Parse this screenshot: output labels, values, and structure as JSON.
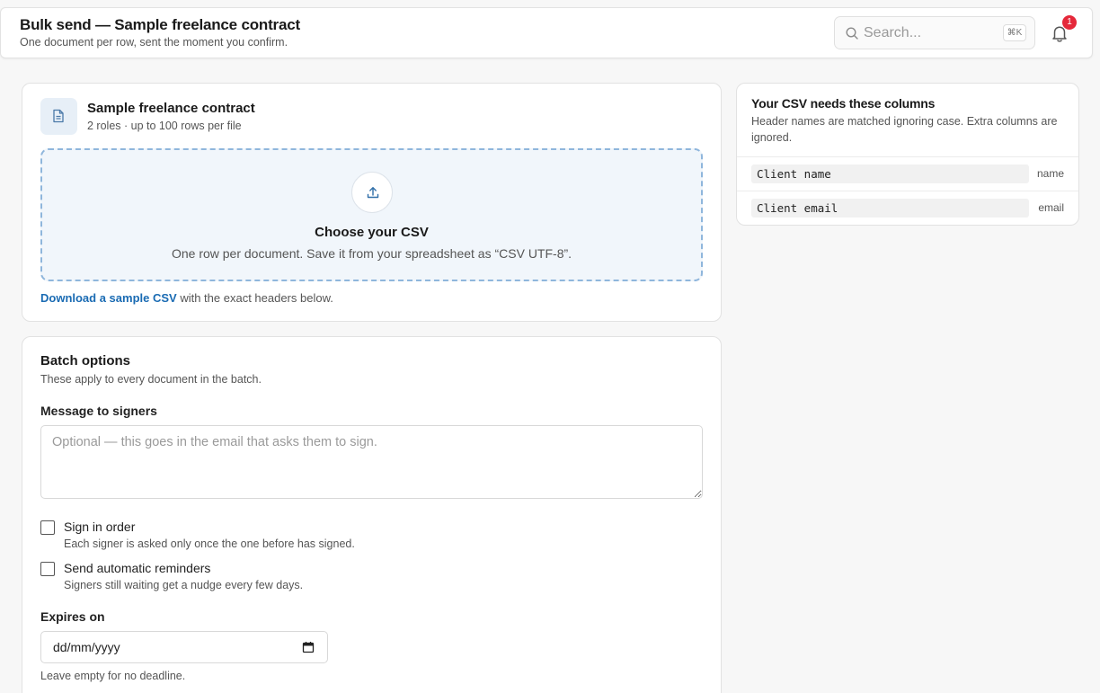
{
  "header": {
    "title": "Bulk send — Sample freelance contract",
    "subtitle": "One document per row, sent the moment you confirm.",
    "search_placeholder": "Search...",
    "search_shortcut": "⌘K",
    "notification_count": "1"
  },
  "template": {
    "name": "Sample freelance contract",
    "meta": "2 roles · up to 100 rows per file"
  },
  "upload": {
    "title": "Choose your CSV",
    "subtitle": "One row per document. Save it from your spreadsheet as “CSV UTF-8”.",
    "sample_link": "Download a sample CSV",
    "sample_suffix": " with the exact headers below."
  },
  "batch_options": {
    "title": "Batch options",
    "subtitle": "These apply to every document in the batch.",
    "message_label": "Message to signers",
    "message_placeholder": "Optional — this goes in the email that asks them to sign.",
    "sign_in_order": {
      "label": "Sign in order",
      "help": "Each signer is asked only once the one before has signed.",
      "checked": false
    },
    "reminders": {
      "label": "Send automatic reminders",
      "help": "Signers still waiting get a nudge every few days.",
      "checked": false
    },
    "expires_label": "Expires on",
    "expires_placeholder": "dd/mm/yyyy",
    "expires_help": "Leave empty for no deadline."
  },
  "csv_columns": {
    "title": "Your CSV needs these columns",
    "subtitle": "Header names are matched ignoring case. Extra columns are ignored.",
    "columns": [
      {
        "header": "Client name",
        "field": "name"
      },
      {
        "header": "Client email",
        "field": "email"
      }
    ]
  },
  "colors": {
    "accent": "#1a6bb3",
    "badge": "#e5283a",
    "dropzone_bg": "#f1f6fb",
    "dropzone_border": "#8fb6dc"
  },
  "icons": {
    "search": "search-icon",
    "bell": "bell-icon",
    "document": "document-icon",
    "upload": "upload-icon",
    "calendar": "calendar-icon"
  }
}
